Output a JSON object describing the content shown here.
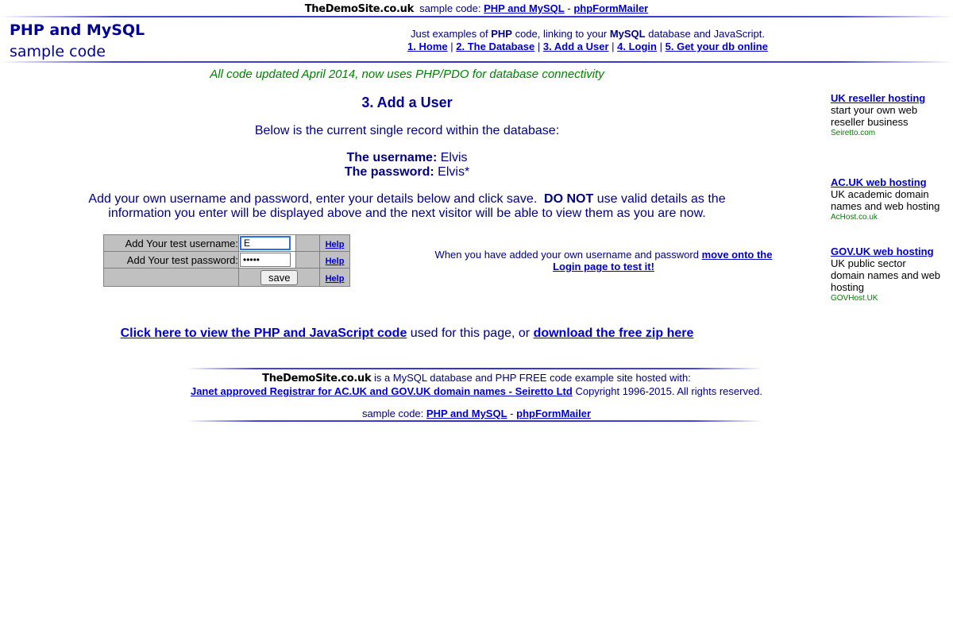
{
  "topbar": {
    "site_name": "TheDemoSite.co.uk",
    "sample_code_label": "sample code:",
    "link_php_mysql": "PHP and MySQL",
    "separator": "-",
    "link_formmailer": "phpFormMailer"
  },
  "logo": {
    "line1": "PHP and MySQL",
    "line2": "sample code"
  },
  "tagline": {
    "text_before": "Just examples of",
    "php": "PHP",
    "text_mid": "code, linking to your",
    "mysql": "MySQL",
    "text_after": "database and JavaScript."
  },
  "nav": {
    "items": [
      "1. Home",
      "2. The Database",
      "3. Add a User",
      "4. Login",
      "5. Get your db online"
    ],
    "separator": "|"
  },
  "notice": "All code updated April 2014, now uses PHP/PDO for database connectivity",
  "heading": "3. Add a User",
  "intro": "Below is the current single record within the database:",
  "record": {
    "username_label": "The username:",
    "username_value": "Elvis",
    "password_label": "The password:",
    "password_value": "Elvis*"
  },
  "instructions": {
    "text_before": "Add your own username and password, enter your details below and click save.",
    "do_not": "DO NOT",
    "text_after": "use valid details as the information you enter will be displayed above and the next visitor will be able to view them as you are now."
  },
  "form": {
    "username_label": "Add Your test username:",
    "username_value": "E",
    "password_label": "Add Your test password:",
    "password_value": "•••••",
    "save_label": "save",
    "help_label": "Help"
  },
  "login_note": {
    "text": "When you have added your own username and password",
    "link": "move onto the Login page to test it!"
  },
  "code_links": {
    "link_view": "Click here to view the PHP and JavaScript code",
    "text_mid": "used for this page, or",
    "link_download": "download the free zip here"
  },
  "footer": {
    "site_name": "TheDemoSite.co.uk",
    "hosted_text": "is a MySQL database and PHP FREE code example site hosted with:",
    "registrar_link": "Janet approved Registrar for AC.UK and GOV.UK domain names - Seiretto Ltd",
    "copyright": "Copyright 1996-2015.  All rights reserved.",
    "sample_code_label": "sample code:",
    "link_php_mysql": "PHP and MySQL",
    "separator": "-",
    "link_formmailer": "phpFormMailer"
  },
  "ads": [
    {
      "title": "UK reseller hosting",
      "desc": "start your own web reseller business",
      "source": "Seiretto.com"
    },
    {
      "title": "AC.UK web hosting",
      "desc": "UK academic domain names and web hosting",
      "source": "AcHost.co.uk"
    },
    {
      "title": "GOV.UK web hosting",
      "desc": "UK public sector domain names and web hosting",
      "source": "GOVHost.UK"
    }
  ],
  "colors": {
    "link": "#0000cc",
    "body_text": "#000080",
    "notice": "#008000",
    "form_bg": "#c0c0c0"
  }
}
